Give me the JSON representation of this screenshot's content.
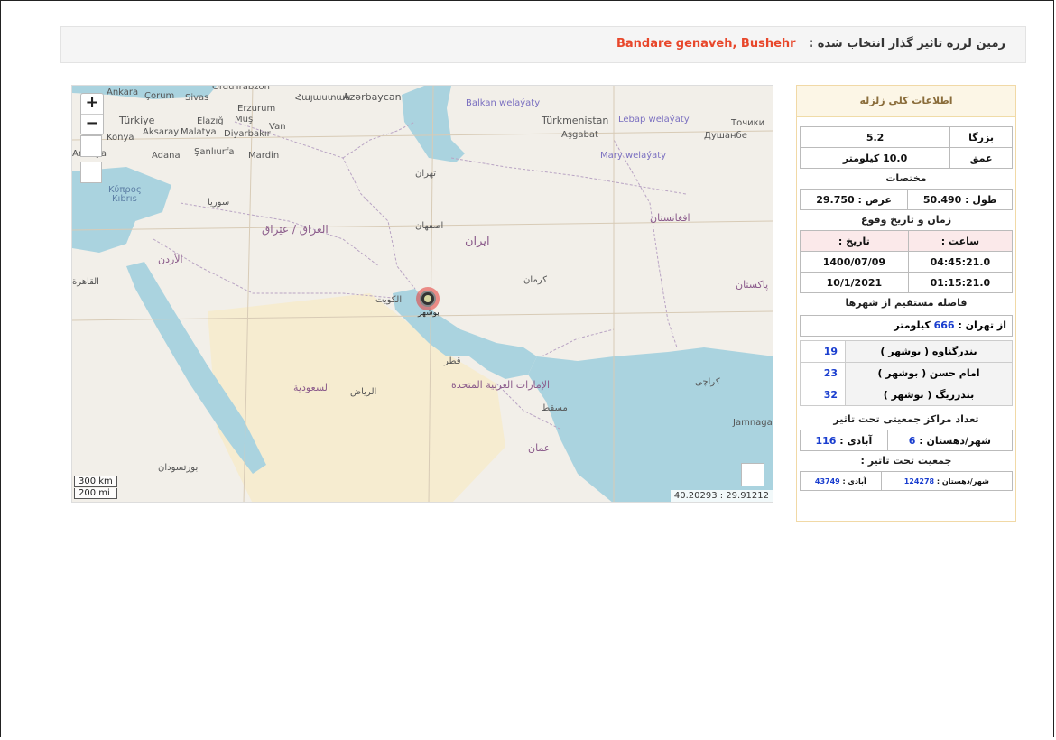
{
  "header": {
    "label": "زمین لرزه تاثیر گذار انتخاب شده :",
    "location": "Bandare genaveh, Bushehr"
  },
  "map": {
    "zoom_in": "+",
    "zoom_out": "−",
    "scale_km": "300 km",
    "scale_mi": "200 mi",
    "coordinates": "40.20293 : 29.91212",
    "labels": {
      "ankara": "Ankara",
      "corum": "Çorum",
      "sivas": "Sivas",
      "ordu": "Ordu",
      "trabzon": "Trabzon",
      "erzurum": "Erzurum",
      "azerbaijan": "Azərbaycan",
      "armenia": "Հայաստան",
      "balkan": "Balkan welaýaty",
      "turkmenistan": "Türkmenistan",
      "lebap": "Lebap welaýaty",
      "tojikiston": "Точики",
      "dushanbe": "Душанбе",
      "turkiye": "Türkiye",
      "elazig": "Elazığ",
      "mus": "Muş",
      "van": "Van",
      "konya": "Konya",
      "aksaray": "Aksaray",
      "malatya": "Malatya",
      "diyarbakir": "Diyarbakır",
      "ashgabat": "Aşgabat",
      "mary": "Mary welaýaty",
      "antalya": "Antalya",
      "adana": "Adana",
      "sanliurfa": "Şanlıurfa",
      "mardin": "Mardin",
      "kibris": "Kıbrıs",
      "kuprus": "Κύπρος",
      "iran": "ایران",
      "iraq": "العراق / عێراق",
      "tehran": "تهران",
      "isfahan": "اصفهان",
      "kerman": "کرمان",
      "bushehr": "بوشهر",
      "saudi": "السعودية",
      "riyadh": "الرياض",
      "kuwait": "الكويت",
      "muscat": "مسقط",
      "oman": "عمان",
      "jamnagar": "Jamnagar",
      "karachi": "کراچی",
      "qatar": "قطر",
      "uae": "الإمارات العربية المتحدة",
      "afghanistan": "افغانستان",
      "pakistan": "پاکستان",
      "suria": "سوريا",
      "jordan": "الأردن",
      "cairo": "القاهرة",
      "sudan": "بورتسودان"
    }
  },
  "panel": {
    "title": "اطلاعات کلی زلزله",
    "magnitude_label": "بزرگا",
    "magnitude_value": "5.2",
    "depth_label": "عمق",
    "depth_value": "10.0 کیلومتر",
    "coords_title": "مختصات",
    "longitude": "طول : 50.490",
    "latitude": "عرض : 29.750",
    "time_title": "زمان و تاریخ وقوع",
    "time_header": "ساعت :",
    "date_header": "تاریخ :",
    "time_local": "04:45:21.0",
    "date_local": "1400/07/09",
    "time_utc": "01:15:21.0",
    "date_utc": "10/1/2021",
    "distance_title": "فاصله مستقیم از شهرها",
    "tehran_prefix": "از تهران :",
    "tehran_value": "666",
    "tehran_unit": "کیلومتر",
    "cities": [
      {
        "name": "بندرگناوه ( بوشهر )",
        "dist": "19"
      },
      {
        "name": "امام حسن ( بوشهر )",
        "dist": "23"
      },
      {
        "name": "بندرریگ ( بوشهر )",
        "dist": "32"
      }
    ],
    "centers_title": "تعداد مراکز جمعیتی تحت تاثیر",
    "city_label": "شهر/دهستان :",
    "city_value": "6",
    "village_label": "آبادی :",
    "village_value": "116",
    "population_title": "جمعیت تحت تاثیر :",
    "pop_city_label": "شهر/دهستان :",
    "pop_city_value": "124278",
    "pop_village_label": "آبادی :",
    "pop_village_value": "43749"
  },
  "colors": {
    "location_red": "#e8472b",
    "value_blue": "#1a3ecf",
    "water": "#aad3df",
    "panel_head": "#fcf6e6"
  }
}
